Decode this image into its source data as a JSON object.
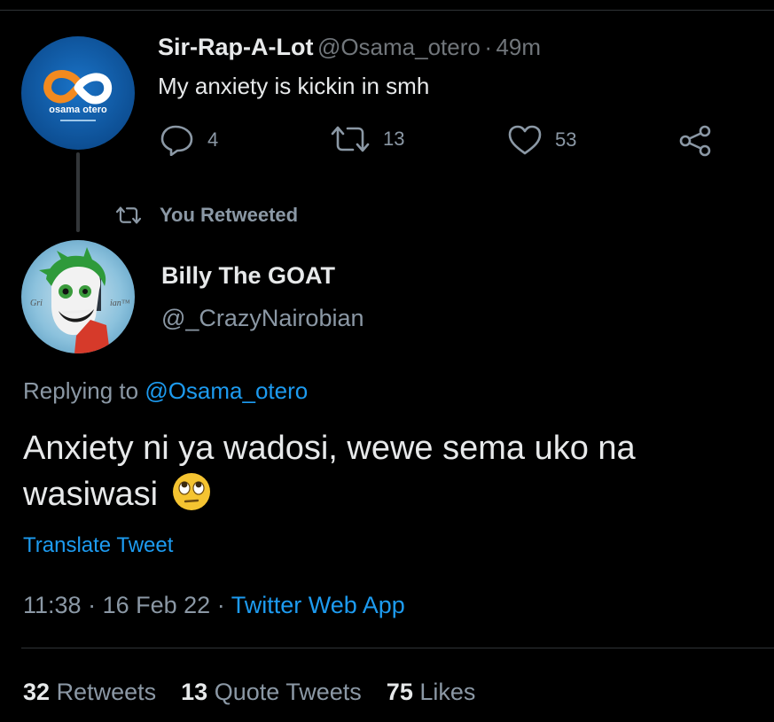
{
  "parent_tweet": {
    "display_name": "Sir-Rap-A-Lot",
    "handle": "@Osama_otero",
    "separator": "·",
    "time_ago": "49m",
    "text": "My anxiety is kickin in smh",
    "avatar_text": "osama otero",
    "actions": {
      "replies": "4",
      "retweets": "13",
      "likes": "53"
    }
  },
  "retweet_banner": {
    "label": "You Retweeted"
  },
  "main_tweet": {
    "display_name": "Billy The GOAT",
    "handle": "@_CrazyNairobian",
    "replying_label": "Replying to",
    "replying_handle": "@Osama_otero",
    "text_line1": "Anxiety ni ya wadosi, wewe sema uko na",
    "text_line2": "wasiwasi",
    "emoji": "🙄",
    "translate_label": "Translate Tweet",
    "time": "11:38",
    "date": "16 Feb 22",
    "dot": "·",
    "source": "Twitter Web App"
  },
  "stats": {
    "retweets_count": "32",
    "retweets_label": "Retweets",
    "quotes_count": "13",
    "quotes_label": "Quote Tweets",
    "likes_count": "75",
    "likes_label": "Likes"
  },
  "colors": {
    "background": "#000000",
    "text": "#e7e9ea",
    "muted": "#8b98a5",
    "link": "#1d9bf0",
    "divider": "#2f3336"
  }
}
